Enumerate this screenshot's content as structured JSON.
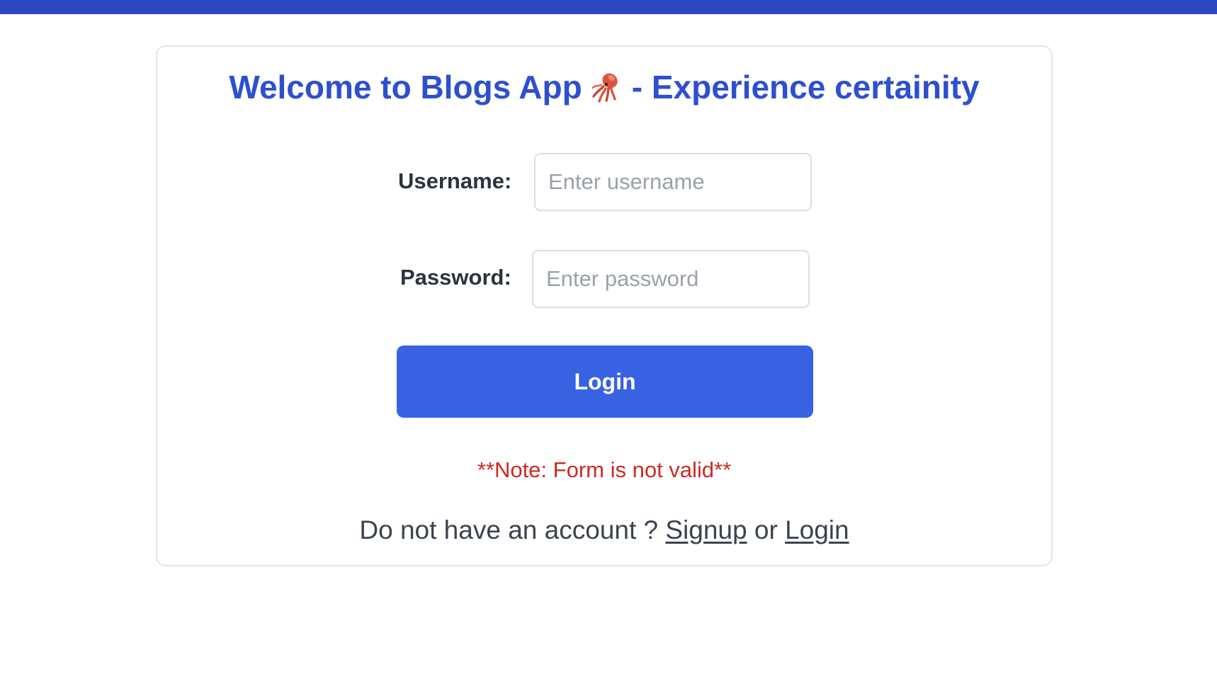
{
  "header": {
    "title_before_icon": "Welcome to Blogs App",
    "title_icon": "squid-icon",
    "title_after_icon": "- Experience certainity"
  },
  "form": {
    "username_label": "Username:",
    "username_placeholder": "Enter username",
    "username_value": "",
    "password_label": "Password:",
    "password_placeholder": "Enter password",
    "password_value": "",
    "login_button_label": "Login"
  },
  "validation": {
    "note": "**Note: Form is not valid**"
  },
  "footer": {
    "prompt_text": "Do not have an account ?",
    "signup_link": "Signup",
    "or_text": "or",
    "login_link": "Login"
  },
  "colors": {
    "top_bar": "#2d47c2",
    "title": "#2d4fd0",
    "button": "#3762e2",
    "error": "#cc2a22"
  }
}
